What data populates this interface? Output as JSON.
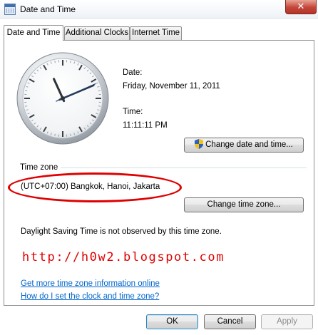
{
  "window": {
    "title": "Date and Time",
    "close_glyph": "✕"
  },
  "tabs": [
    {
      "label": "Date and Time",
      "active": true
    },
    {
      "label": "Additional Clocks",
      "active": false
    },
    {
      "label": "Internet Time",
      "active": false
    }
  ],
  "clock": {
    "hour": 11,
    "minute": 11,
    "second": 11
  },
  "date": {
    "label": "Date:",
    "value": "Friday, November 11, 2011"
  },
  "time": {
    "label": "Time:",
    "value": "11:11:11 PM"
  },
  "buttons": {
    "change_date_time": "Change date and time...",
    "change_time_zone": "Change time zone...",
    "ok": "OK",
    "cancel": "Cancel",
    "apply": "Apply"
  },
  "timezone": {
    "label": "Time zone",
    "value": "(UTC+07:00) Bangkok, Hanoi, Jakarta"
  },
  "dst_note": "Daylight Saving Time is not observed by this time zone.",
  "watermark": "http://h0w2.blogspot.com",
  "links": {
    "more_info": "Get more time zone information online",
    "how_set": "How do I set the clock and time zone?"
  },
  "icons": {
    "app": "calendar-clock-icon",
    "shield": "uac-shield-icon"
  },
  "colors": {
    "annotation_red": "#e00000",
    "link_blue": "#0066cc",
    "close_red": "#c4453a"
  }
}
